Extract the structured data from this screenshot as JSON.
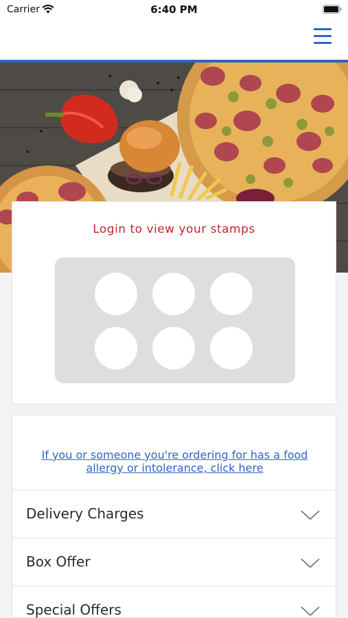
{
  "status_bar": {
    "carrier": "Carrier",
    "time": "6:40 PM"
  },
  "nav": {
    "menu_icon": "hamburger-menu-icon",
    "accent_color": "#2f63c6"
  },
  "hero": {
    "image": "food-photo"
  },
  "stamps": {
    "title": "Login to view your stamps",
    "title_color": "#c0262c",
    "count": 6,
    "collected": 0
  },
  "info": {
    "allergy_link": "If you or someone you're ordering for has a food allergy or intolerance, click here",
    "sections": [
      {
        "label": "Delivery Charges"
      },
      {
        "label": "Box Offer"
      },
      {
        "label": "Special Offers"
      }
    ]
  }
}
